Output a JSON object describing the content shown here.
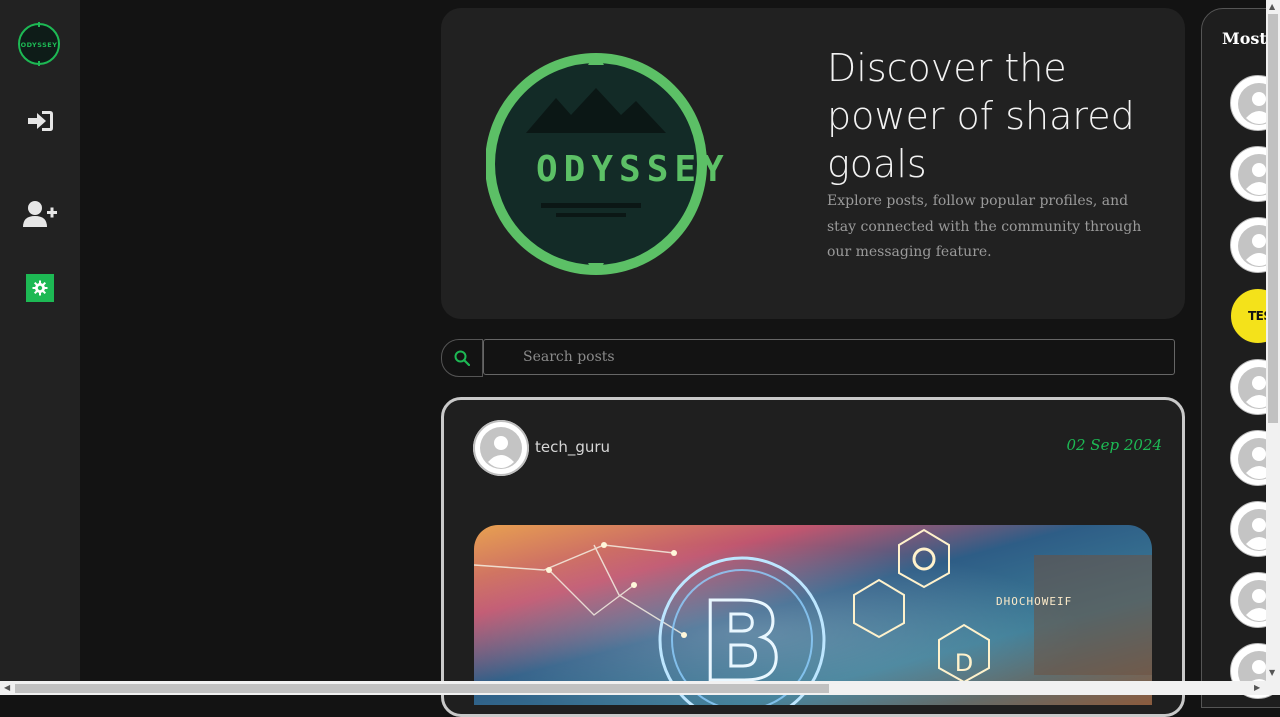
{
  "sidebar": {
    "logo_text": "ODYSSEY",
    "items": [
      {
        "name": "login-icon"
      },
      {
        "name": "add-user-icon"
      },
      {
        "name": "gear-icon"
      }
    ]
  },
  "hero": {
    "logo_text": "ODYSSEY",
    "title": "Discover the power of shared goals",
    "subtitle": "Explore posts, follow popular profiles, and stay connected with the community through our messaging feature."
  },
  "search": {
    "placeholder": "Search posts",
    "icon": "search-icon"
  },
  "post": {
    "username": "tech_guru",
    "date": "02 Sep 2024",
    "image_text": "DHOCHOWEIF"
  },
  "right_panel": {
    "title": "Most",
    "profiles": [
      {
        "kind": "default"
      },
      {
        "kind": "default"
      },
      {
        "kind": "default"
      },
      {
        "kind": "custom",
        "label": "TESTI"
      },
      {
        "kind": "default"
      },
      {
        "kind": "default"
      },
      {
        "kind": "default"
      },
      {
        "kind": "default"
      },
      {
        "kind": "default"
      }
    ]
  },
  "colors": {
    "accent": "#1db954",
    "sidebar_bg": "#222222",
    "page_bg": "#131313",
    "card_bg": "#212121"
  }
}
